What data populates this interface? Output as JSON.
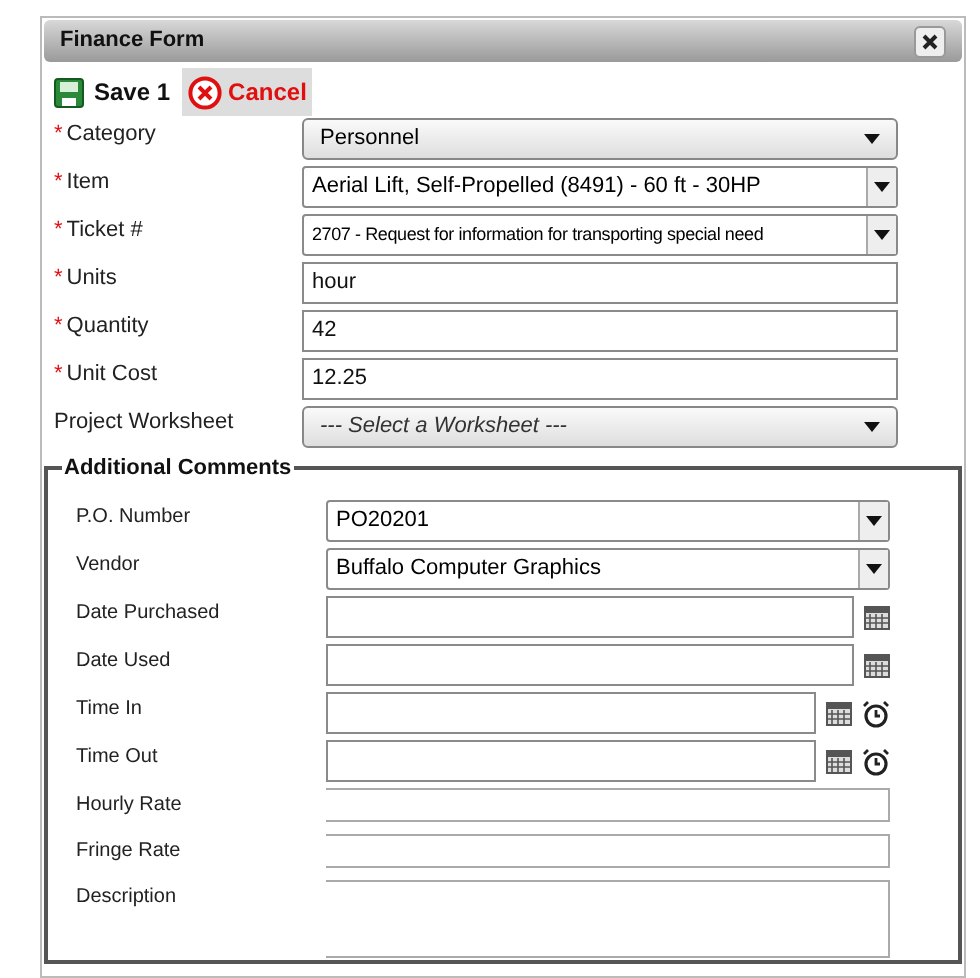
{
  "window": {
    "title": "Finance Form"
  },
  "toolbar": [
    {
      "kind": "save",
      "label": "Save 1"
    },
    {
      "kind": "cancel",
      "label": "Cancel"
    }
  ],
  "fields": [
    {
      "label": "Category",
      "marker": "*",
      "kind": "select",
      "value": "Personnel"
    },
    {
      "label": "Item",
      "marker": "*",
      "kind": "combo",
      "value": "Aerial Lift, Self-Propelled (8491) - 60 ft - 30HP"
    },
    {
      "label": "Ticket #",
      "marker": "*",
      "kind": "combo",
      "value": "2707 - Request for information for transporting special need"
    },
    {
      "label": "Units",
      "marker": "*",
      "kind": "text",
      "value": "hour"
    },
    {
      "label": "Quantity",
      "marker": "*",
      "kind": "text",
      "value": "42"
    },
    {
      "label": "Unit Cost",
      "marker": "*",
      "kind": "text",
      "value": "12.25"
    },
    {
      "label": "Project Worksheet",
      "kind": "select",
      "placeholder": "--- Select a Worksheet ---"
    }
  ],
  "additional_comments": {
    "legend": "Additional Comments",
    "fields": [
      {
        "label": "P.O. Number",
        "kind": "combo",
        "value": "PO20201"
      },
      {
        "label": "Vendor",
        "kind": "combo",
        "value": "Buffalo Computer Graphics"
      },
      {
        "label": "Date Purchased",
        "kind": "date"
      },
      {
        "label": "Date Used",
        "kind": "date"
      },
      {
        "label": "Time In",
        "kind": "time"
      },
      {
        "label": "Time Out",
        "kind": "time"
      },
      {
        "label": "Hourly Rate",
        "kind": "plain"
      },
      {
        "label": "Fringe Rate",
        "kind": "plain"
      },
      {
        "label": "Description",
        "kind": "textarea"
      }
    ]
  }
}
